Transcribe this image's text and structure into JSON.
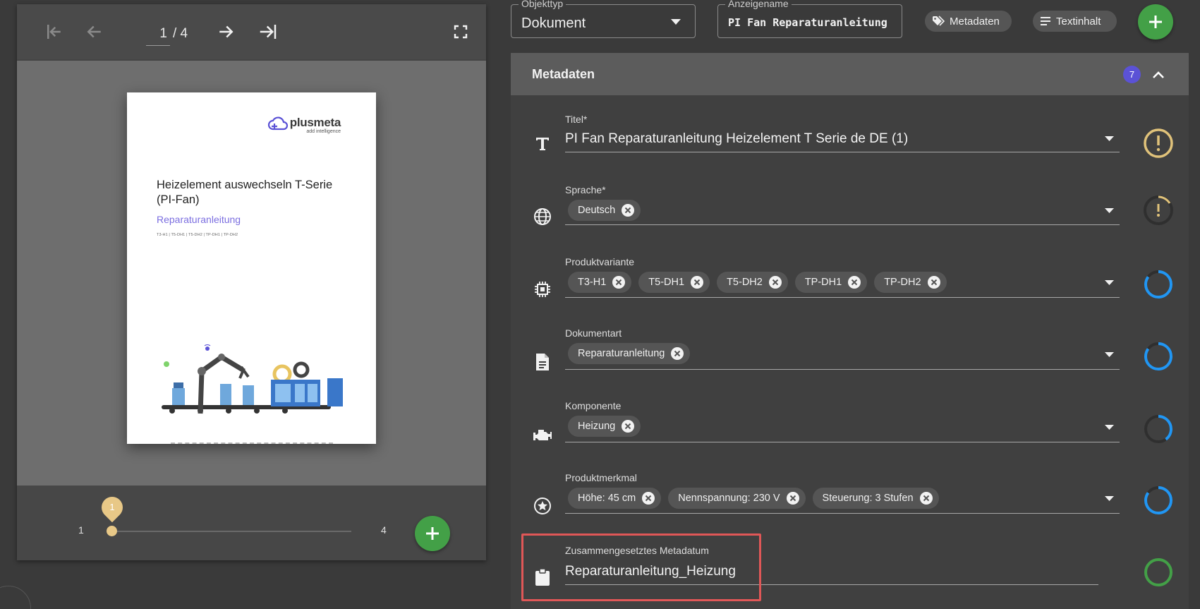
{
  "viewer": {
    "toolbar": {
      "current_page": "1",
      "page_separator": "/ 4"
    },
    "document": {
      "logo_text": "plusmeta",
      "logo_tagline": "add intelligence",
      "title": "Heizelement auswechseln T-Serie (PI-Fan)",
      "subtitle": "Reparaturanleitung",
      "codes": "T3-H1 | T5-DH1 | T5-DH2 | TP-DH1 | TP-DH2"
    },
    "slider": {
      "min": "1",
      "max": "4",
      "value": "1",
      "value_fraction": 0
    }
  },
  "header": {
    "objekttyp_label": "Objekttyp",
    "objekttyp_value": "Dokument",
    "anzeigename_label": "Anzeigename",
    "anzeigename_value": "PI Fan Reparaturanleitung",
    "metadaten_button": "Metadaten",
    "textinhalt_button": "Textinhalt"
  },
  "metadata": {
    "title": "Metadaten",
    "count_badge": "7",
    "fields": {
      "titel": {
        "label": "Titel*",
        "value": "PI Fan Reparaturanleitung Heizelement T Serie de DE (1)",
        "status": "warning"
      },
      "sprache": {
        "label": "Sprache*",
        "chips": [
          "Deutsch"
        ],
        "status": "warning-loading"
      },
      "produktvariante": {
        "label": "Produktvariante",
        "chips": [
          "T3-H1",
          "T5-DH1",
          "T5-DH2",
          "TP-DH1",
          "TP-DH2"
        ],
        "status": "loading",
        "progress": 0.85
      },
      "dokumentart": {
        "label": "Dokumentart",
        "chips": [
          "Reparaturanleitung"
        ],
        "status": "loading",
        "progress": 0.85
      },
      "komponente": {
        "label": "Komponente",
        "chips": [
          "Heizung"
        ],
        "status": "loading",
        "progress": 0.4
      },
      "produktmerkmal": {
        "label": "Produktmerkmal",
        "chips": [
          "Höhe: 45 cm",
          "Nennspannung: 230 V",
          "Steuerung: 3 Stufen"
        ],
        "status": "loading",
        "progress": 0.85
      },
      "zusammengesetzt": {
        "label": "Zusammengesetztes Metadatum",
        "value": "Reparaturanleitung_Heizung",
        "status": "done"
      }
    }
  },
  "colors": {
    "accent_green": "#43a047",
    "badge_purple": "#5b52d6",
    "warning_gold": "#e0c27a",
    "progress_blue": "#2196f3",
    "highlight_red": "#e05757"
  }
}
